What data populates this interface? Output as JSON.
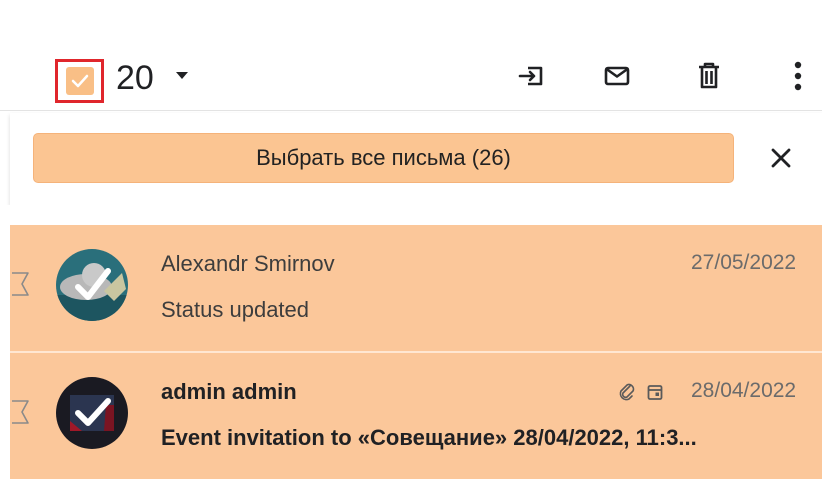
{
  "toolbar": {
    "selected_count": "20",
    "icons": [
      "move-icon",
      "envelope-icon",
      "trash-icon",
      "more-vertical-icon"
    ]
  },
  "banner": {
    "select_all_label": "Выбрать все письма (26)"
  },
  "messages": [
    {
      "sender": "Alexandr Smirnov",
      "subject": "Status updated",
      "date": "27/05/2022",
      "unread": false,
      "selected": true
    },
    {
      "sender": "admin admin",
      "subject": "Event invitation to «Совещание» 28/04/2022, 11:3...",
      "date": "28/04/2022",
      "unread": true,
      "selected": true,
      "icons": [
        "attachment-icon",
        "calendar-icon"
      ]
    }
  ],
  "colors": {
    "selected_row": "#fbc79a",
    "select_all_button": "#fbc592",
    "highlight_frame": "#e0262c",
    "checkbox": "#f9bf86"
  }
}
